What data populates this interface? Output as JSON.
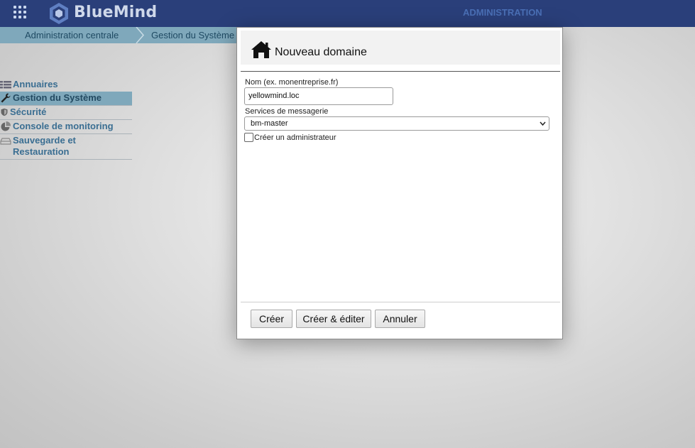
{
  "topbar": {
    "logo_text": "BlueMind",
    "section": "ADMINISTRATION",
    "brand_color": "#2a3f7a"
  },
  "breadcrumb": [
    "Administration centrale",
    "Gestion du Système"
  ],
  "sidebar": {
    "items": [
      {
        "label": "Annuaires",
        "icon": "list-icon",
        "active": false
      },
      {
        "label": "Gestion du Système",
        "icon": "wrench-icon",
        "active": true
      },
      {
        "label": "Sécurité",
        "icon": "shield-icon",
        "active": false
      },
      {
        "label": "Console de monitoring",
        "icon": "pie-chart-icon",
        "active": false
      },
      {
        "label": "Sauvegarde et Restauration",
        "icon": "drive-icon",
        "active": false
      }
    ]
  },
  "dialog": {
    "title": "Nouveau domaine",
    "icon": "home-icon",
    "name_label": "Nom (ex. monentreprise.fr)",
    "name_value": "yellowmind.loc",
    "mail_label": "Services de messagerie",
    "mail_selected": "bm-master",
    "create_admin_label": "Créer un administrateur",
    "create_admin_checked": false,
    "buttons": {
      "create": "Créer",
      "create_edit": "Créer & éditer",
      "cancel": "Annuler"
    }
  }
}
